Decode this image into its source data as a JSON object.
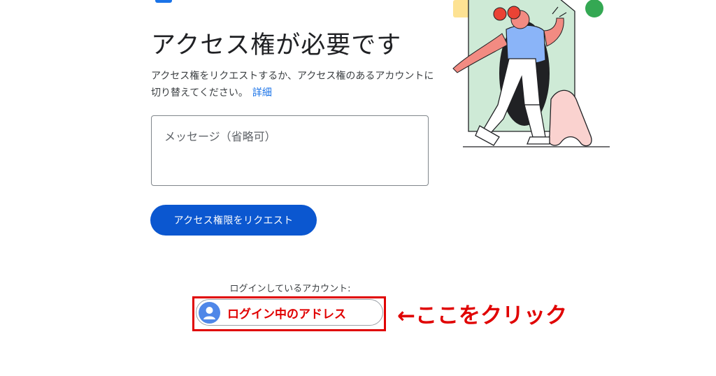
{
  "page": {
    "title": "アクセス権が必要です",
    "description": "アクセス権をリクエストするか、アクセス権のあるアカウントに切り替えてください。",
    "details_link": "詳細"
  },
  "message": {
    "placeholder": "メッセージ（省略可）"
  },
  "request_button": {
    "label": "アクセス権限をリクエスト"
  },
  "account": {
    "signed_in_label": "ログインしているアカウント:",
    "address": "ログイン中のアドレス"
  },
  "annotation": {
    "text": "←ここをクリック"
  },
  "colors": {
    "accent": "#0b57d0",
    "link": "#1a73e8",
    "highlight": "#e00000"
  }
}
